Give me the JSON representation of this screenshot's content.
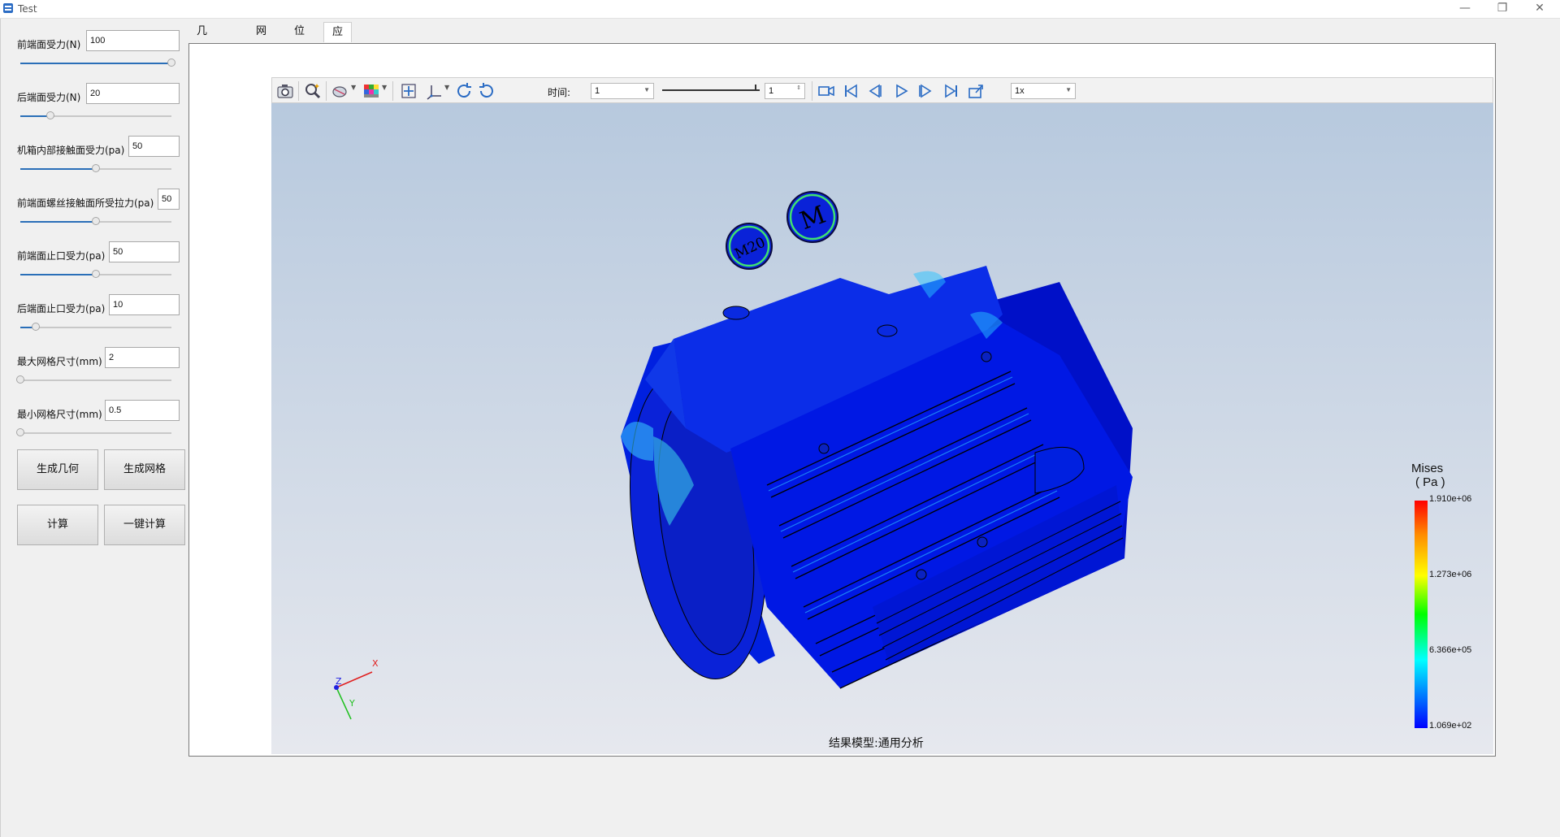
{
  "window": {
    "title": "Test"
  },
  "params": [
    {
      "label": "前端面受力(N)",
      "value": "100",
      "fraction": 1.0
    },
    {
      "label": "后端面受力(N)",
      "value": "20",
      "fraction": 0.2
    },
    {
      "label": "机箱内部接触面受力(pa)",
      "value": "50",
      "fraction": 0.5
    },
    {
      "label": "前端面螺丝接触面所受拉力(pa)",
      "value": "50",
      "fraction": 0.5
    },
    {
      "label": "前端面止口受力(pa)",
      "value": "50",
      "fraction": 0.5
    },
    {
      "label": "后端面止口受力(pa)",
      "value": "10",
      "fraction": 0.1
    },
    {
      "label": "最大网格尺寸(mm)",
      "value": "2",
      "fraction": 0.0
    },
    {
      "label": "最小网格尺寸(mm)",
      "value": "0.5",
      "fraction": 0.0
    }
  ],
  "buttons": {
    "gen_geometry": "生成几何",
    "gen_mesh": "生成网格",
    "compute": "计算",
    "one_click": "一键计算"
  },
  "tabs": [
    "几何结构",
    "网格",
    "位移",
    "应力"
  ],
  "active_tab": "应力",
  "toolbar": {
    "time_label": "时间:",
    "time_value": "1",
    "frame_value": "1",
    "speed_value": "1x"
  },
  "viewport": {
    "model_labels": [
      "M20",
      "M"
    ],
    "caption": "结果模型:通用分析",
    "axes": {
      "x": "X",
      "y": "Y",
      "z": "Z"
    }
  },
  "legend": {
    "title_line1": "Mises",
    "title_line2": "( Pa )",
    "values": [
      "1.910e+06",
      "1.273e+06",
      "6.366e+05",
      "1.069e+02"
    ]
  },
  "colors": {
    "accent": "#2a6fb8",
    "model_base": "#0018e8"
  }
}
